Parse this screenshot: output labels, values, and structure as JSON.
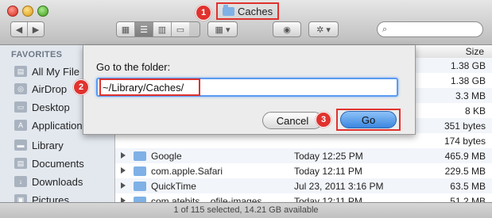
{
  "window": {
    "title": "Caches",
    "status_text": "1 of 115 selected, 14.21 GB available"
  },
  "annotations": [
    {
      "number": "1"
    },
    {
      "number": "2"
    },
    {
      "number": "3"
    }
  ],
  "sidebar": {
    "heading": "FAVORITES",
    "items": [
      {
        "label": "All My File",
        "icon": "all-files-icon"
      },
      {
        "label": "AirDrop",
        "icon": "airdrop-icon"
      },
      {
        "label": "Desktop",
        "icon": "desktop-icon"
      },
      {
        "label": "Applications",
        "icon": "applications-icon"
      },
      {
        "label": "Library",
        "icon": "folder-icon"
      },
      {
        "label": "Documents",
        "icon": "documents-icon"
      },
      {
        "label": "Downloads",
        "icon": "downloads-icon"
      },
      {
        "label": "Pictures",
        "icon": "pictures-icon"
      }
    ]
  },
  "file_list": {
    "size_header": "Size",
    "rows": [
      {
        "name": "",
        "date": "",
        "size": "1.38 GB"
      },
      {
        "name": "",
        "date": "",
        "size": "1.38 GB"
      },
      {
        "name": "",
        "date": "",
        "size": "3.3 MB"
      },
      {
        "name": "",
        "date": "",
        "size": "8 KB"
      },
      {
        "name": "",
        "date": "",
        "size": "351 bytes"
      },
      {
        "name": "",
        "date": "",
        "size": "174 bytes"
      },
      {
        "name": "Google",
        "date": "Today 12:25 PM",
        "size": "465.9 MB"
      },
      {
        "name": "com.apple.Safari",
        "date": "Today 12:11 PM",
        "size": "229.5 MB"
      },
      {
        "name": "QuickTime",
        "date": "Jul 23, 2011 3:16 PM",
        "size": "63.5 MB"
      },
      {
        "name": "com.atebits....ofile-images",
        "date": "Today 12:11 PM",
        "size": "51.2 MB"
      }
    ]
  },
  "dialog": {
    "label": "Go to the folder:",
    "path_value": "~/Library/Caches/",
    "cancel_label": "Cancel",
    "go_label": "Go"
  },
  "colors": {
    "annotation_red": "#e0322e",
    "go_button_blue": "#3a86e0",
    "sidebar_bg": "#e3e8ef"
  }
}
